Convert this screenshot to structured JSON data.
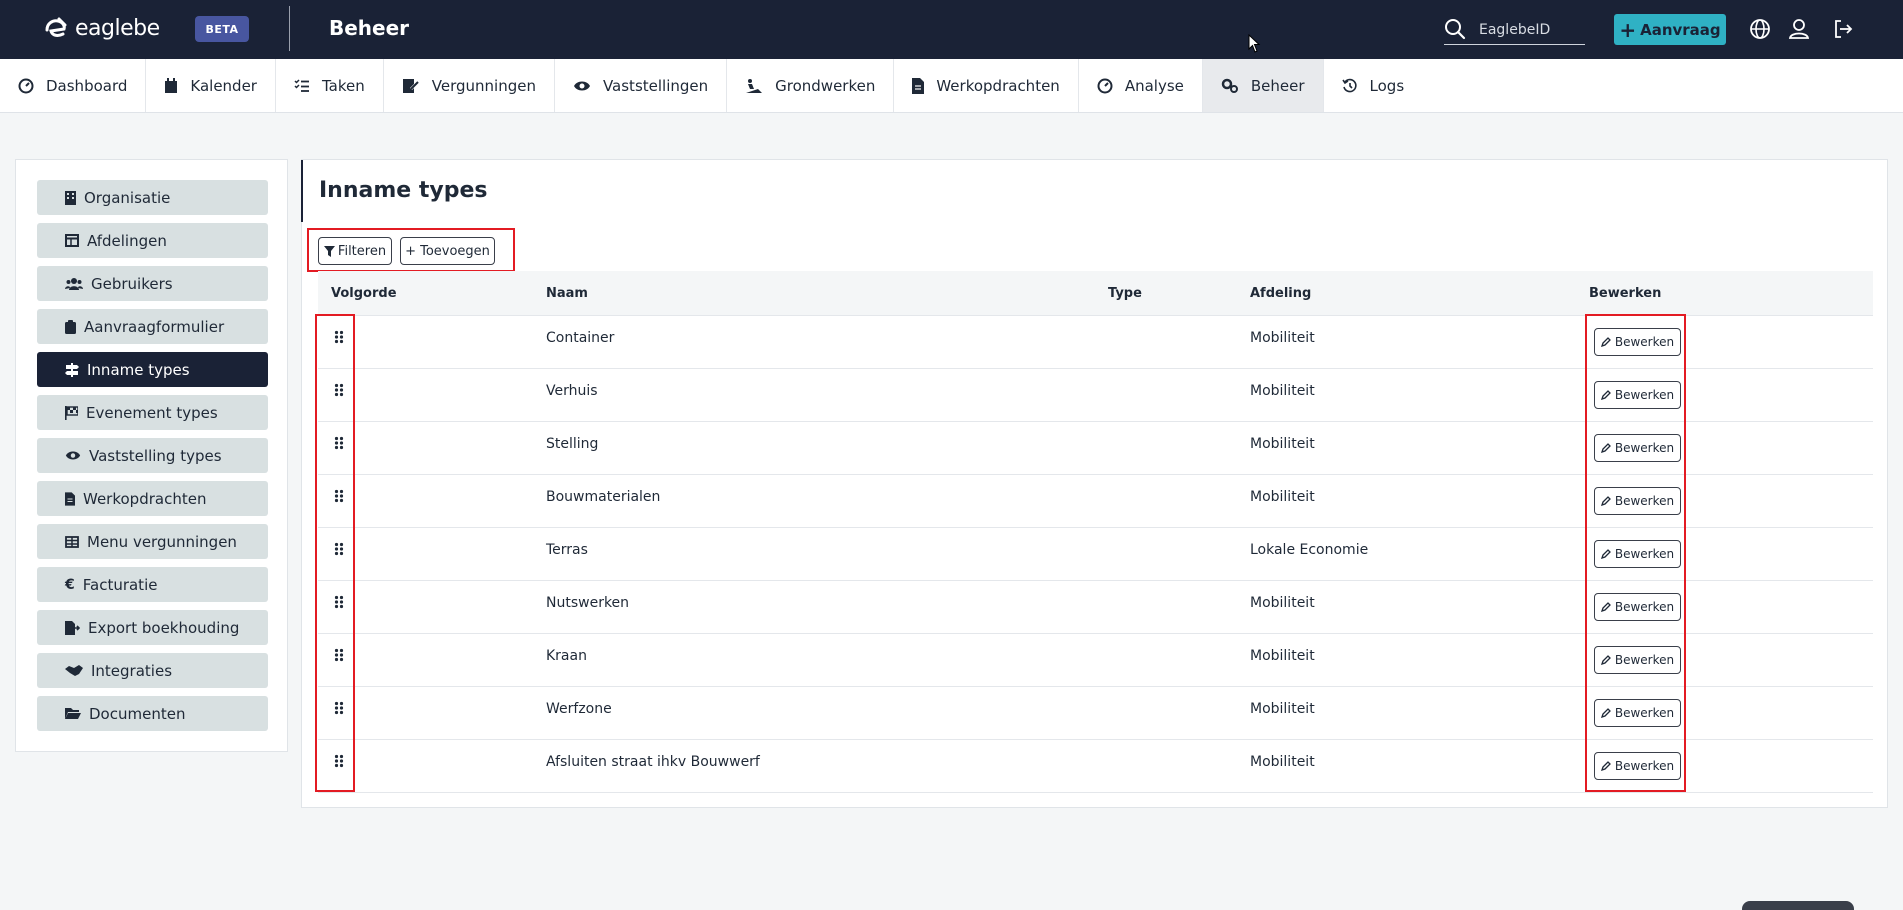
{
  "topbar": {
    "logo_text": "eaglebe",
    "beta_label": "BETA",
    "app_title": "Beheer",
    "search_placeholder": "EaglebeID",
    "request_button": "Aanvraag"
  },
  "nav": {
    "items": [
      {
        "label": "Dashboard",
        "icon": "dashboard-icon"
      },
      {
        "label": "Kalender",
        "icon": "calendar-icon"
      },
      {
        "label": "Taken",
        "icon": "tasks-icon"
      },
      {
        "label": "Vergunningen",
        "icon": "permit-icon"
      },
      {
        "label": "Vaststellingen",
        "icon": "eye-icon"
      },
      {
        "label": "Grondwerken",
        "icon": "digging-icon"
      },
      {
        "label": "Werkopdrachten",
        "icon": "document-icon"
      },
      {
        "label": "Analyse",
        "icon": "gauge-icon"
      },
      {
        "label": "Beheer",
        "icon": "cogs-icon",
        "active": true
      },
      {
        "label": "Logs",
        "icon": "history-icon"
      }
    ]
  },
  "sidebar": {
    "items": [
      {
        "label": "Organisatie",
        "icon": "building-icon"
      },
      {
        "label": "Afdelingen",
        "icon": "table-icon"
      },
      {
        "label": "Gebruikers",
        "icon": "users-icon"
      },
      {
        "label": "Aanvraagformulier",
        "icon": "clipboard-icon"
      },
      {
        "label": "Inname types",
        "icon": "signs-icon",
        "active": true
      },
      {
        "label": "Evenement types",
        "icon": "flag-icon"
      },
      {
        "label": "Vaststelling types",
        "icon": "eye-icon"
      },
      {
        "label": "Werkopdrachten",
        "icon": "document-icon"
      },
      {
        "label": "Menu vergunningen",
        "icon": "grid-icon"
      },
      {
        "label": "Facturatie",
        "icon": "euro-icon"
      },
      {
        "label": "Export boekhouding",
        "icon": "file-export-icon"
      },
      {
        "label": "Integraties",
        "icon": "handshake-icon"
      },
      {
        "label": "Documenten",
        "icon": "folder-icon"
      }
    ]
  },
  "main": {
    "title": "Inname types",
    "filter_button": "Filteren",
    "add_button": "+ Toevoegen",
    "columns": [
      "Volgorde",
      "Naam",
      "Type",
      "Afdeling",
      "Bewerken"
    ],
    "edit_label": "Bewerken",
    "rows": [
      {
        "naam": "Container",
        "type": "",
        "afdeling": "Mobiliteit"
      },
      {
        "naam": "Verhuis",
        "type": "",
        "afdeling": "Mobiliteit"
      },
      {
        "naam": "Stelling",
        "type": "",
        "afdeling": "Mobiliteit"
      },
      {
        "naam": "Bouwmaterialen",
        "type": "",
        "afdeling": "Mobiliteit"
      },
      {
        "naam": "Terras",
        "type": "",
        "afdeling": "Lokale Economie"
      },
      {
        "naam": "Nutswerken",
        "type": "",
        "afdeling": "Mobiliteit"
      },
      {
        "naam": "Kraan",
        "type": "",
        "afdeling": "Mobiliteit"
      },
      {
        "naam": "Werfzone",
        "type": "",
        "afdeling": "Mobiliteit"
      },
      {
        "naam": "Afsluiten straat ihkv Bouwwerf",
        "type": "",
        "afdeling": "Mobiliteit"
      }
    ]
  },
  "colors": {
    "topbar": "#1a2236",
    "accent": "#2fb1c4",
    "highlight": "#e31b23",
    "sidebar_item": "#d8e0e1"
  }
}
